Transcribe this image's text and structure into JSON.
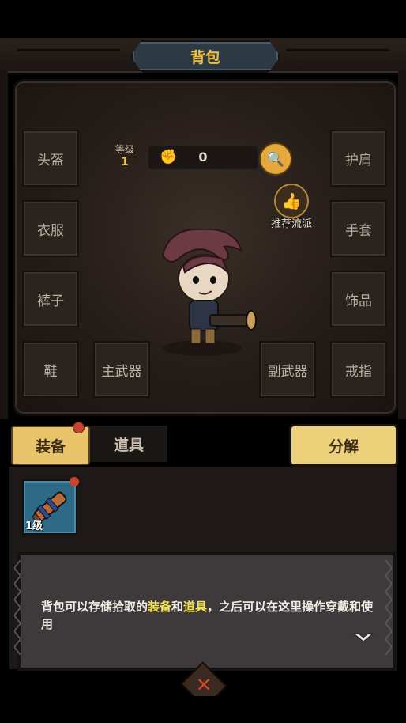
{
  "header": {
    "title": "背包"
  },
  "equipment_slots": {
    "helmet": "头盔",
    "shoulder": "护肩",
    "clothes": "衣服",
    "gloves": "手套",
    "pants": "裤子",
    "accessory": "饰品",
    "shoes": "鞋",
    "main_weapon": "主武器",
    "sub_weapon": "副武器",
    "ring": "戒指"
  },
  "stats": {
    "level_label": "等级",
    "level_value": "1",
    "power_value": "0"
  },
  "recommend": {
    "label": "推荐流派"
  },
  "tabs": {
    "equipment": "装备",
    "items": "道具"
  },
  "decompose_label": "分解",
  "inventory": [
    {
      "level_label": "1级",
      "icon": "cannon-weapon-icon"
    }
  ],
  "dialog": {
    "text_before": "背包可以存储拾取的",
    "highlight1": "装备",
    "text_mid": "和",
    "highlight2": "道具",
    "text_after": "，之后可以在这里操作穿戴和使用"
  },
  "colors": {
    "accent": "#f2c13b",
    "highlight": "#f5e356",
    "badge": "#c8442f",
    "button": "#ecd07a"
  }
}
